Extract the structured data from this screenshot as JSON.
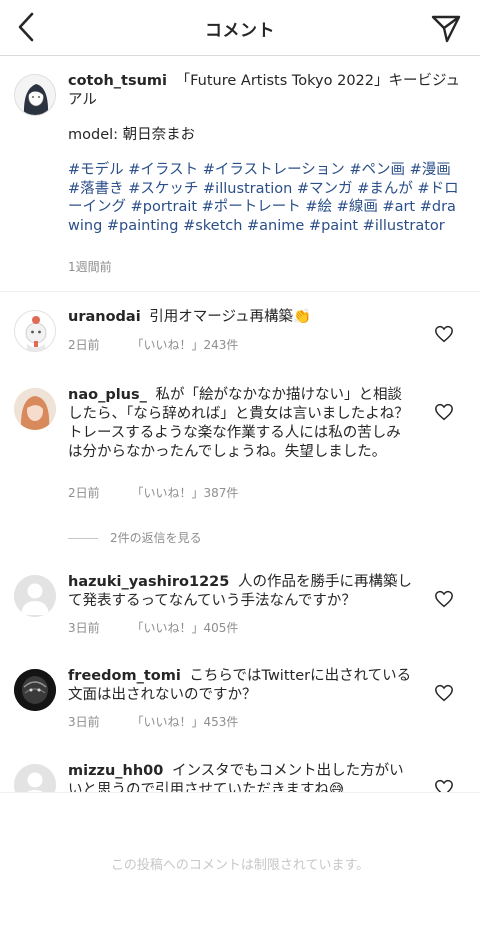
{
  "header": {
    "title": "コメント"
  },
  "caption": {
    "username": "cotoh_tsumi",
    "text": "「Future Artists Tokyo 2022」キービジュアル",
    "model_line": "model: 朝日奈まお",
    "hashtags": "#モデル #イラスト #イラストレーション #ペン画 #漫画 #落書き #スケッチ #illustration #マンガ #まんが #ドローイング #portrait #ポートレート #絵 #線画 #art #drawing #painting #sketch #anime #paint #illustrator",
    "time": "1週間前"
  },
  "comments": [
    {
      "username": "uranodai",
      "text": "引用オマージュ再構築👏",
      "time": "2日前",
      "likes": "「いいね！」243件"
    },
    {
      "username": "nao_plus_",
      "text": "私が「絵がなかなか描けない」と相談したら、「なら辞めれば」と貴女は言いましたよね？トレースするような楽な作業する人には私の苦しみは分からなかったんでしょうね。失望しました。",
      "time": "2日前",
      "likes": "「いいね！」387件"
    },
    {
      "username": "hazuki_yashiro1225",
      "text": "人の作品を勝手に再構築して発表するってなんていう手法なんですか？",
      "time": "3日前",
      "likes": "「いいね！」405件"
    },
    {
      "username": "freedom_tomi",
      "text": "こちらではTwitterに出されている文面は出されないのですか？",
      "time": "3日前",
      "likes": "「いいね！」453件"
    },
    {
      "username": "mizzu_hh00",
      "text": "インスタでもコメント出した方がいいと思うので引用させていただきますね😅"
    }
  ],
  "view_replies": "2件の返信を見る",
  "footer": {
    "restricted_text": "この投稿へのコメントは制限されています。"
  },
  "colors": {
    "hashtag": "#2b4f88",
    "meta": "#8e8e8e"
  }
}
